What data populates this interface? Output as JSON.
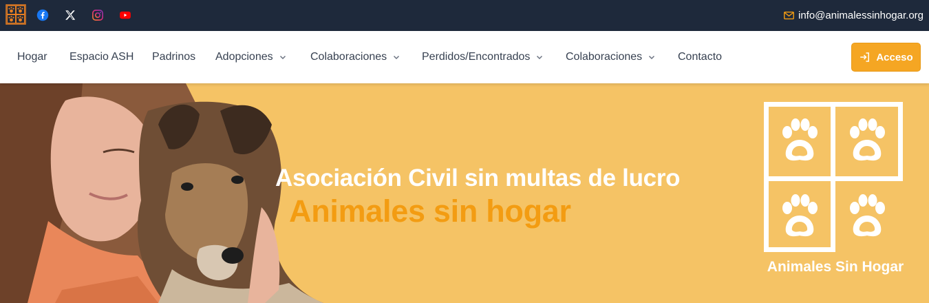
{
  "header": {
    "logo_icon": "paw-grid-logo-icon",
    "social": [
      {
        "name": "facebook-icon",
        "color": "#1877f2"
      },
      {
        "name": "x-icon",
        "color": "#ffffff"
      },
      {
        "name": "instagram-icon",
        "color": "#c13584"
      },
      {
        "name": "youtube-icon",
        "color": "#ff0000"
      }
    ],
    "email": "info@animalessinhogar.org",
    "email_icon": "mail-icon"
  },
  "nav": {
    "items": [
      {
        "label": "Hogar",
        "dropdown": false
      },
      {
        "label": "Espacio ASH",
        "dropdown": false
      },
      {
        "label": "Padrinos",
        "dropdown": false
      },
      {
        "label": "Adopciones",
        "dropdown": true
      },
      {
        "label": "Colaboraciones",
        "dropdown": true
      },
      {
        "label": "Perdidos/Encontrados",
        "dropdown": true
      },
      {
        "label": "Colaboraciones",
        "dropdown": true
      },
      {
        "label": "Contacto",
        "dropdown": false
      }
    ],
    "login_label": "Acceso",
    "login_icon": "login-icon"
  },
  "hero": {
    "title": "Asociación Civil sin multas de lucro",
    "subtitle": "Animales sin hogar",
    "brand_name": "Animales Sin Hogar",
    "accent": "#f39c12",
    "background": "#f5c365"
  }
}
